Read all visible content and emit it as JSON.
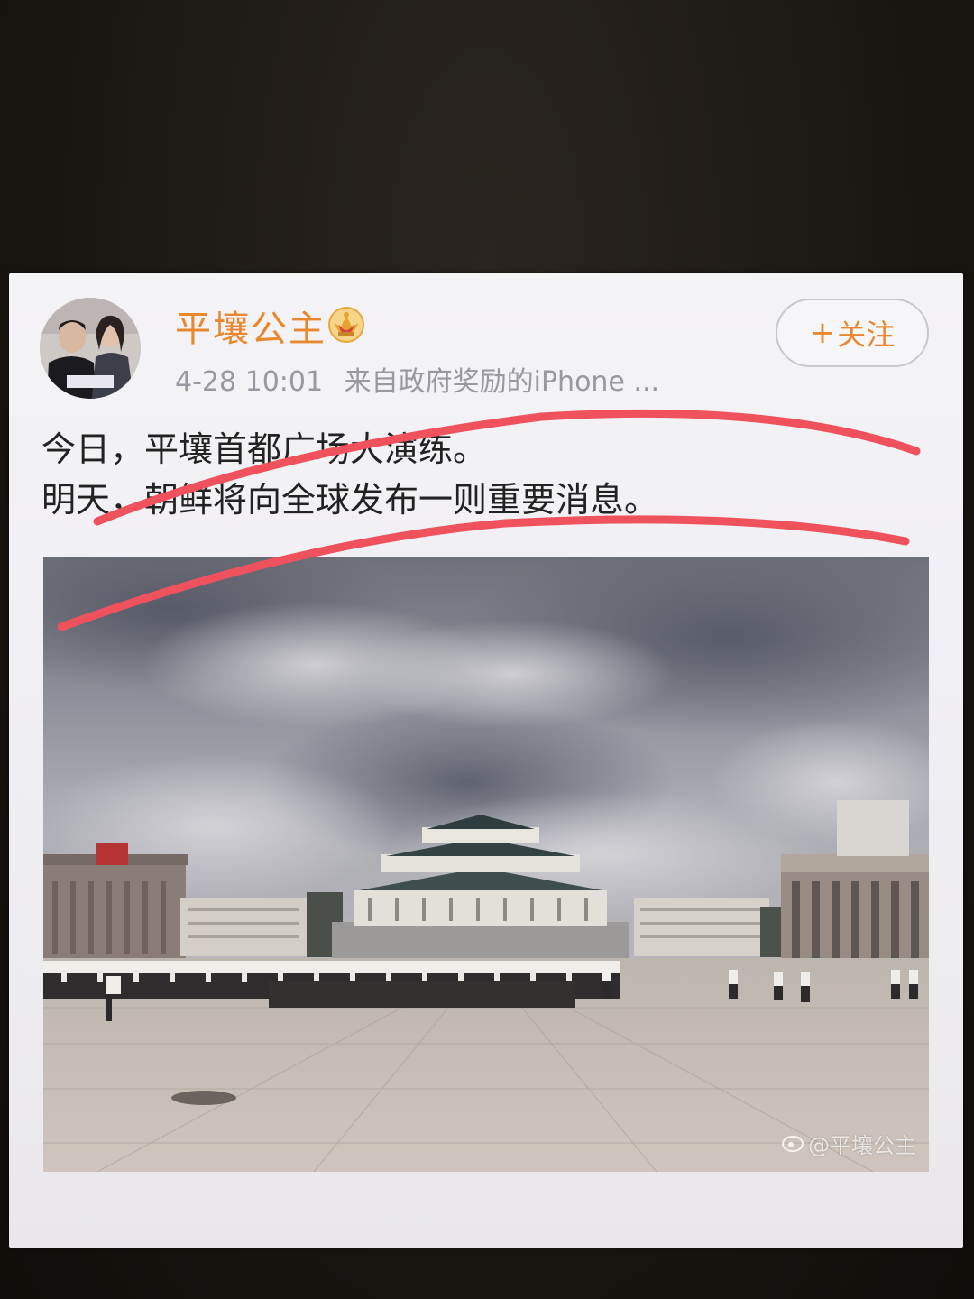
{
  "post": {
    "username": "平壤公主",
    "badge_icon": "crown-badge-icon",
    "timestamp": "4-28 10:01",
    "source": "来自政府奖励的iPhone ...",
    "follow_label": "关注",
    "follow_plus": "+",
    "text_lines": [
      "今日，平壤首都广场大演练。",
      "明天，朝鲜将向全球发布一则重要消息。"
    ],
    "image_watermark": "@平壤公主"
  },
  "colors": {
    "accent_orange": "#e8882e",
    "annotation_red": "#f0525d",
    "meta_gray": "#9a97a0"
  }
}
